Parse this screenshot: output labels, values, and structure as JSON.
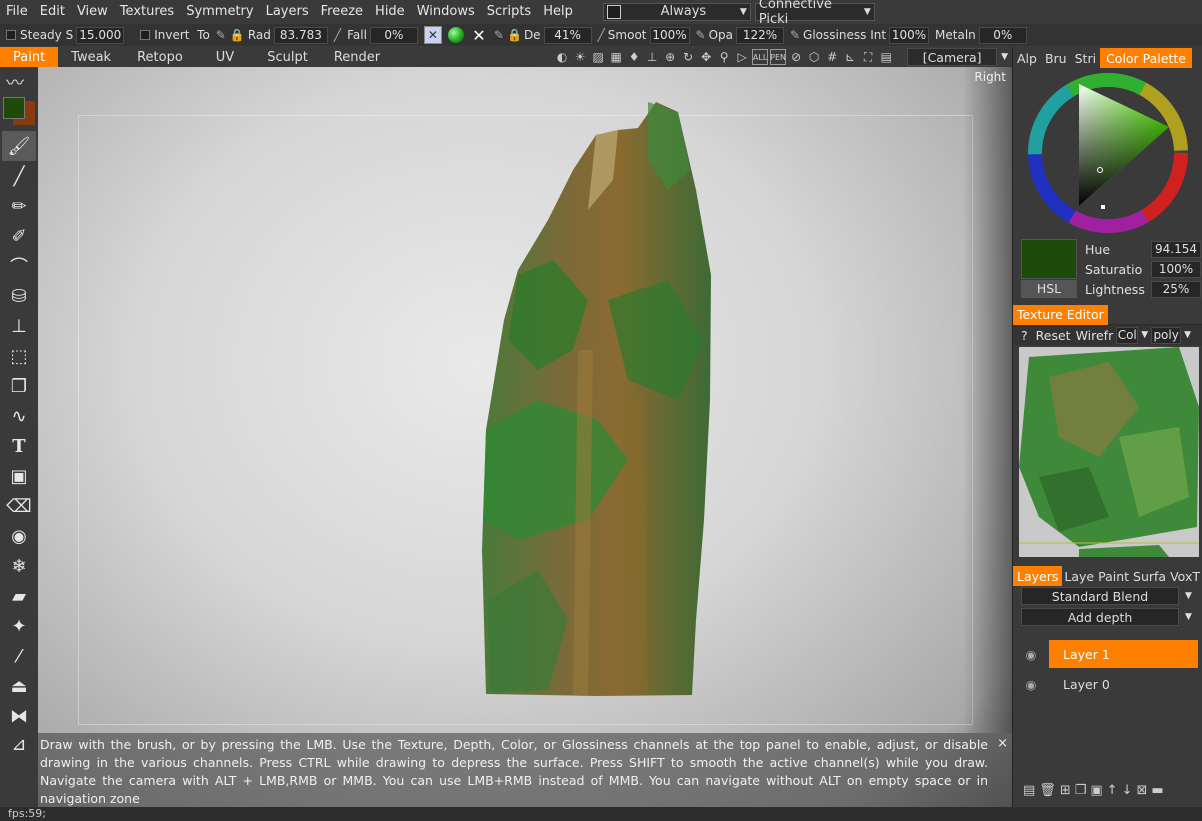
{
  "menu": [
    "File",
    "Edit",
    "View",
    "Textures",
    "Symmetry",
    "Layers",
    "Freeze",
    "Hide",
    "Windows",
    "Scripts",
    "Help"
  ],
  "menu_combo1": "Always",
  "menu_combo2": "Connective Picki",
  "toolbar": {
    "steady_label": "Steady",
    "steady_s_label": "S",
    "steady_value": "15.000",
    "invert_label": "Invert",
    "to_label": "To",
    "radius_label": "Rad",
    "radius_value": "83.783",
    "falloff_label": "Fall",
    "falloff_value": "0%",
    "depth_label": "De",
    "depth_value": "41%",
    "smooth_label": "Smoot",
    "smooth_value": "100%",
    "opacity_label": "Opa",
    "opacity_value": "122%",
    "glossiness_label": "Glossiness",
    "glossiness_int_label": "Int",
    "glossiness_value": "100%",
    "metalness_label": "Metaln",
    "metalness_value": "0%"
  },
  "modes": [
    "Paint",
    "Tweak",
    "Retopo",
    "UV",
    "Sculpt",
    "Render"
  ],
  "camera_dropdown": "[Camera]",
  "viewport": {
    "view_label": "Right",
    "hint": "Draw with the brush, or by pressing the LMB. Use the Texture, Depth, Color, or Glossiness channels at the top panel to enable, adjust, or disable drawing in the various channels. Press CTRL while drawing to depress the surface. Press SHIFT to smooth the active channel(s) while you draw. Navigate the camera with ALT + LMB,RMB or MMB. You can use LMB+RMB instead of MMB. You can navigate without ALT on empty space or in navigation zone",
    "hint_close": "×"
  },
  "right_tabs_top": [
    "Alp",
    "Bru",
    "Stri",
    "Color Palette"
  ],
  "color": {
    "swatch_hex": "#1e4a0a",
    "mode_label": "HSL",
    "hue_label": "Hue",
    "hue_value": "94.154",
    "saturation_label": "Saturatio",
    "saturation_value": "100%",
    "lightness_label": "Lightness",
    "lightness_value": "25%"
  },
  "texture_editor": {
    "title": "Texture Editor",
    "help": "?",
    "reset": "Reset",
    "wireframe": "Wirefr",
    "channel": "Col",
    "mode": "poly"
  },
  "layer_tabs": [
    "Layers",
    "Laye",
    "Paint",
    "Surfa",
    "VoxT"
  ],
  "layers": {
    "blend": "Standard Blend",
    "depth_mode": "Add depth",
    "items": [
      "Layer  1",
      "Layer  0"
    ]
  },
  "status": "fps:59;",
  "accent_color": "#ff7f00"
}
